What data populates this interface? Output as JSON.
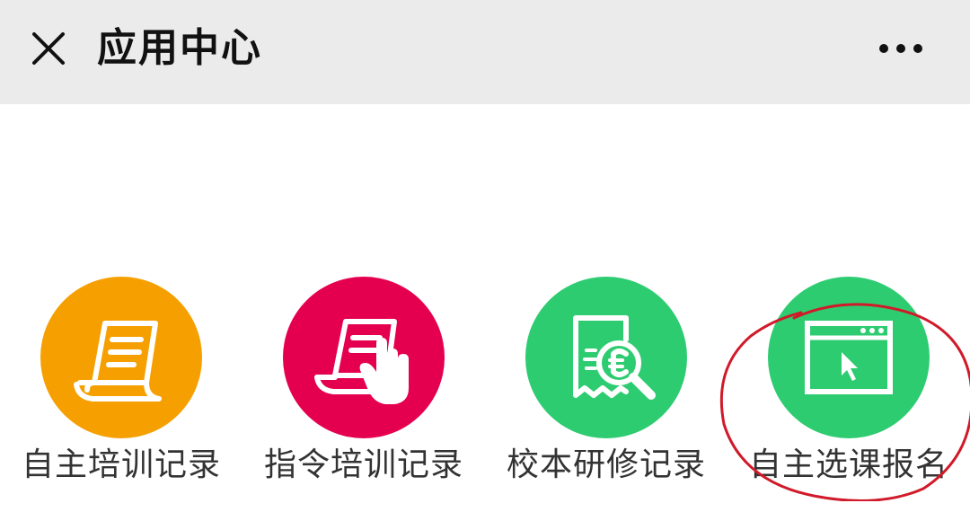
{
  "header": {
    "title": "应用中心",
    "close_icon": "close-icon",
    "more_icon": "more-dots-icon"
  },
  "apps": [
    {
      "label": "自主培训记录",
      "icon": "document-scroll-icon",
      "color": "#f5a000"
    },
    {
      "label": "指令培训记录",
      "icon": "document-hand-pointer-icon",
      "color": "#e5004f"
    },
    {
      "label": "校本研修记录",
      "icon": "receipt-magnifier-icon",
      "color": "#2ecc71"
    },
    {
      "label": "自主选课报名",
      "icon": "browser-cursor-icon",
      "color": "#2ecc71"
    }
  ],
  "annotation_color": "#d01a2a"
}
